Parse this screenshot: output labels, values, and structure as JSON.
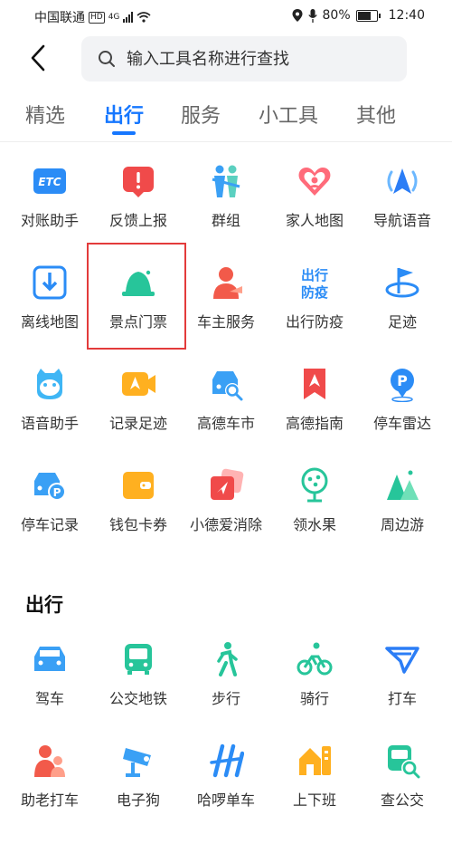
{
  "status": {
    "carrier": "中国联通",
    "hd": "HD",
    "network": "4G",
    "battery": "80%",
    "battery_level": 0.8,
    "time": "12:40"
  },
  "search": {
    "placeholder": "输入工具名称进行查找"
  },
  "tabs": [
    {
      "label": "精选"
    },
    {
      "label": "出行"
    },
    {
      "label": "服务"
    },
    {
      "label": "小工具"
    },
    {
      "label": "其他"
    }
  ],
  "grid": [
    {
      "label": "对账助手"
    },
    {
      "label": "反馈上报"
    },
    {
      "label": "群组"
    },
    {
      "label": "家人地图"
    },
    {
      "label": "导航语音"
    },
    {
      "label": "离线地图"
    },
    {
      "label": "景点门票"
    },
    {
      "label": "车主服务"
    },
    {
      "label": "出行防疫"
    },
    {
      "label": "足迹"
    },
    {
      "label": "语音助手"
    },
    {
      "label": "记录足迹"
    },
    {
      "label": "高德车市"
    },
    {
      "label": "高德指南"
    },
    {
      "label": "停车雷达"
    },
    {
      "label": "停车记录"
    },
    {
      "label": "钱包卡券"
    },
    {
      "label": "小德爱消除"
    },
    {
      "label": "领水果"
    },
    {
      "label": "周边游"
    }
  ],
  "grid_icon_text": {
    "etc": "ETC",
    "epidemic": [
      "出行",
      "防疫"
    ],
    "parking": "P"
  },
  "section": {
    "title": "出行",
    "items": [
      {
        "label": "驾车"
      },
      {
        "label": "公交地铁"
      },
      {
        "label": "步行"
      },
      {
        "label": "骑行"
      },
      {
        "label": "打车"
      },
      {
        "label": "助老打车"
      },
      {
        "label": "电子狗"
      },
      {
        "label": "哈啰单车"
      },
      {
        "label": "上下班"
      },
      {
        "label": "查公交"
      }
    ]
  },
  "colors": {
    "accent": "#1677ff",
    "highlight": "#e33b3b"
  }
}
